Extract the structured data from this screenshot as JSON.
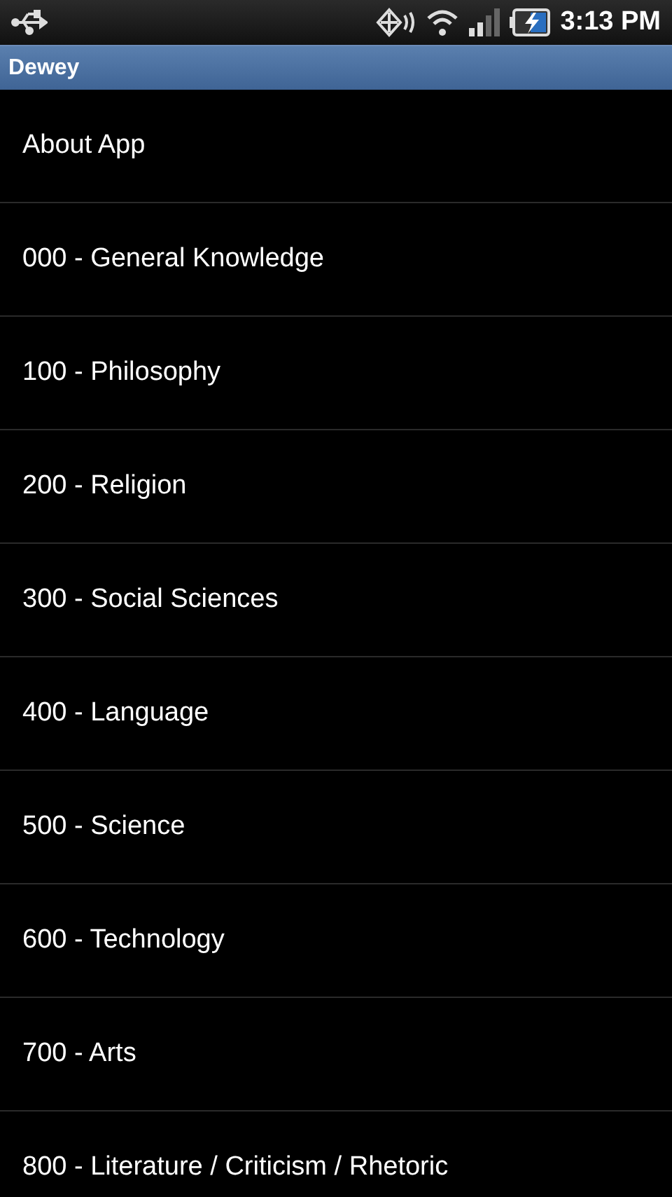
{
  "status_bar": {
    "time": "3:13 PM"
  },
  "window": {
    "title": "Dewey"
  },
  "items": [
    {
      "label": "About App"
    },
    {
      "label": "000 - General Knowledge"
    },
    {
      "label": "100 - Philosophy"
    },
    {
      "label": "200 - Religion"
    },
    {
      "label": "300 - Social Sciences"
    },
    {
      "label": "400 - Language"
    },
    {
      "label": "500 - Science"
    },
    {
      "label": "600 - Technology"
    },
    {
      "label": "700 - Arts"
    },
    {
      "label": "800 - Literature / Criticism / Rhetoric"
    }
  ]
}
